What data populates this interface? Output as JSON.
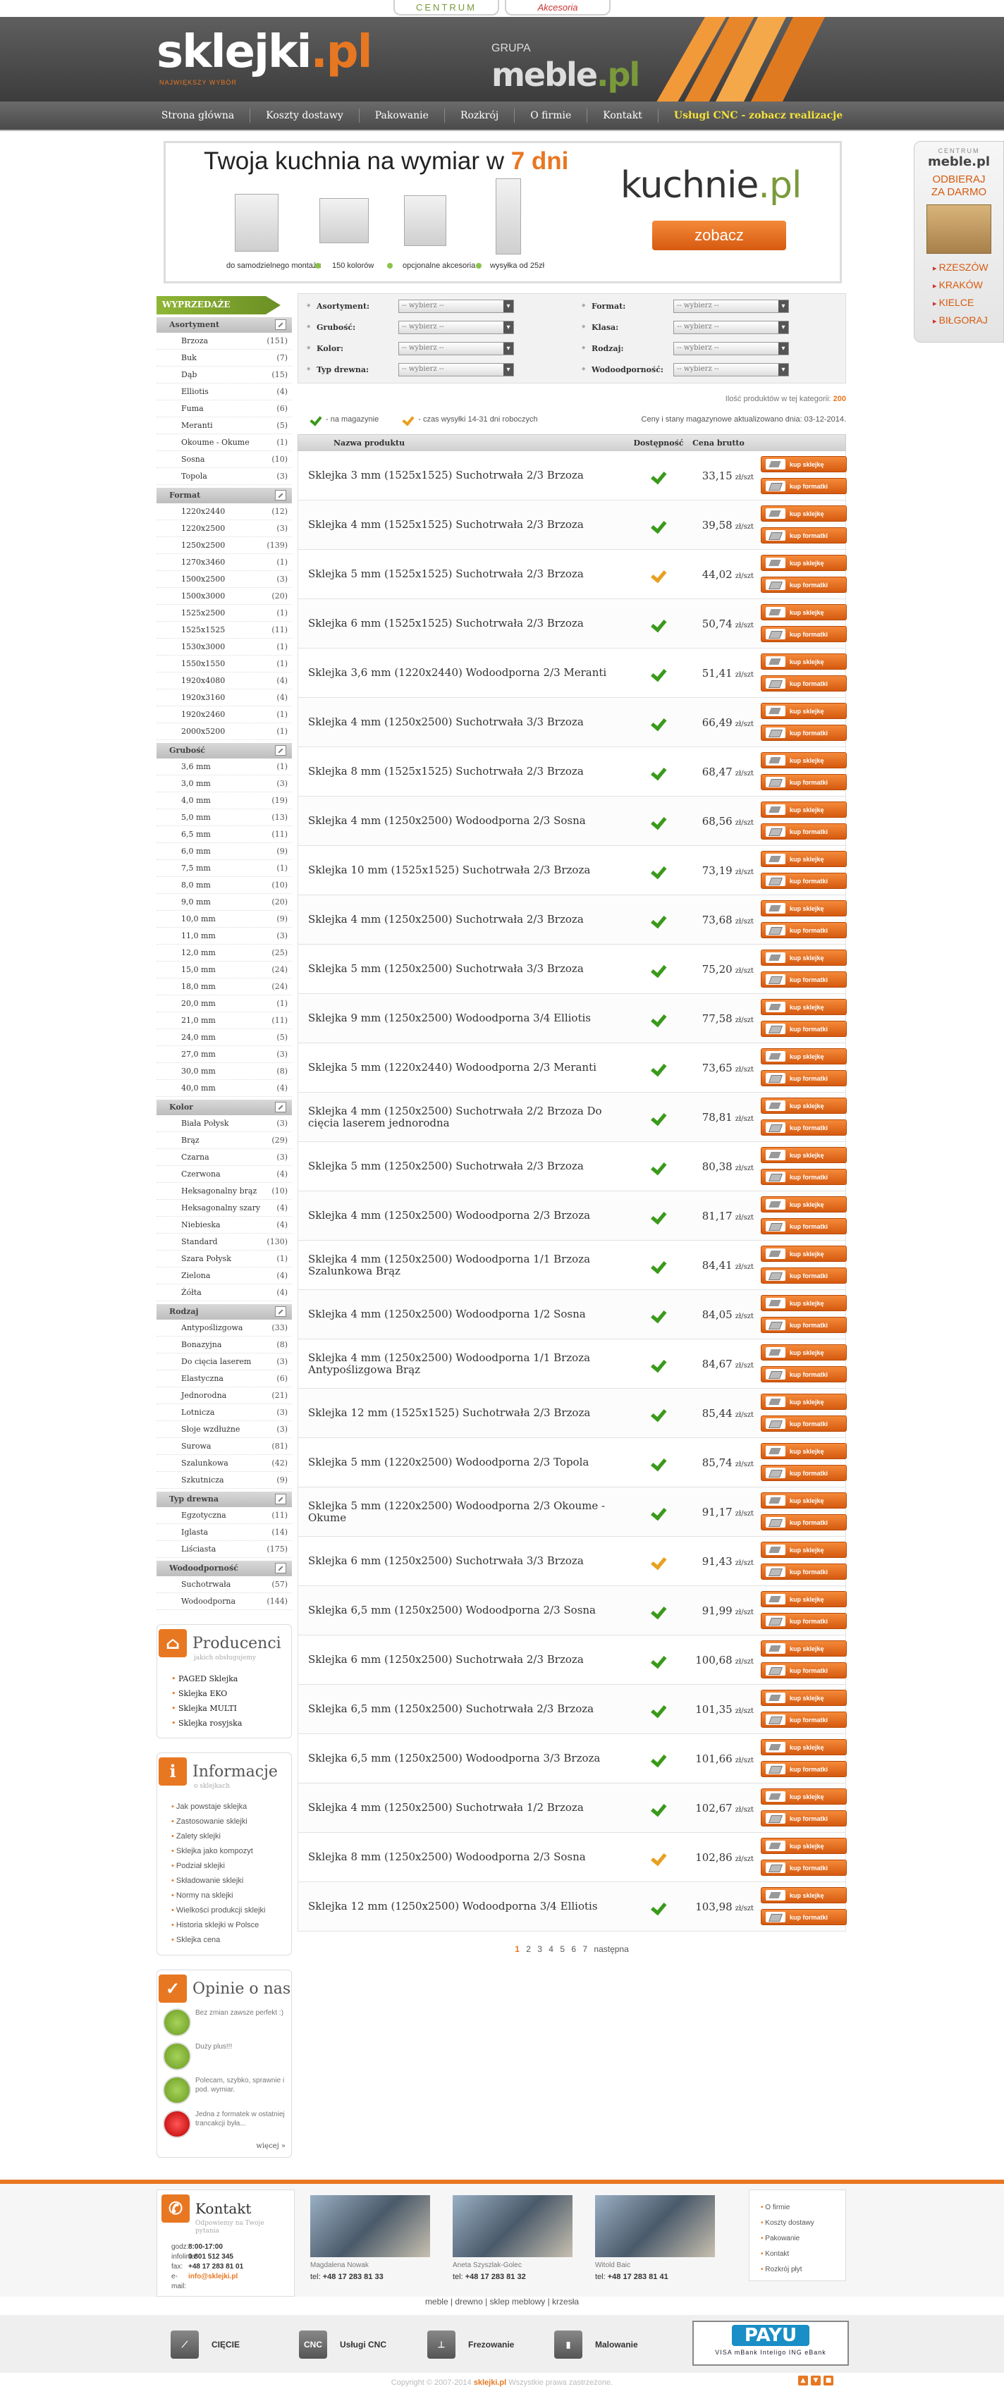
{
  "top_tabs": {
    "centrum": "CENTRUM",
    "akcesoria": "Akcesoria"
  },
  "header": {
    "logo": "sklejki",
    "logo_dot": ".pl",
    "logo_sub": "NAJWIĘKSZY WYBÓR",
    "grupa": "GRUPA",
    "meble": "meble",
    "meble_dot": ".pl"
  },
  "nav": [
    "Strona główna",
    "Koszty dostawy",
    "Pakowanie",
    "Rozkrój",
    "O firmie",
    "Kontakt",
    "Usługi CNC - zobacz realizacje"
  ],
  "banner": {
    "title_pre": "Twoja kuchnia na wymiar w ",
    "title_hl": "7 dni",
    "captions": [
      "do samodzielnego montażu",
      "150 kolorów",
      "opcjonalne akcesoria",
      "wysyłka od 25zł"
    ],
    "brand": "kuchnie",
    "brand_dot": ".pl",
    "cta": "zobacz"
  },
  "sidebox": {
    "centrum": "CENTRUM",
    "meble": "meble.pl",
    "odbieraj": "ODBIERAJ",
    "za_darmo": "ZA DARMO",
    "cities": [
      "RZESZÓW",
      "KRAKÓW",
      "KIELCE",
      "BIŁGORAJ"
    ]
  },
  "sidebar": {
    "wyprzedaze": "WYPRZEDAŻE",
    "groups": [
      {
        "title": "Asortyment",
        "items": [
          [
            "Brzoza",
            "(151)"
          ],
          [
            "Buk",
            "(7)"
          ],
          [
            "Dąb",
            "(15)"
          ],
          [
            "Elliotis",
            "(4)"
          ],
          [
            "Fuma",
            "(6)"
          ],
          [
            "Meranti",
            "(5)"
          ],
          [
            "Okoume - Okume",
            "(1)"
          ],
          [
            "Sosna",
            "(10)"
          ],
          [
            "Topola",
            "(3)"
          ]
        ]
      },
      {
        "title": "Format",
        "items": [
          [
            "1220x2440",
            "(12)"
          ],
          [
            "1220x2500",
            "(3)"
          ],
          [
            "1250x2500",
            "(139)"
          ],
          [
            "1270x3460",
            "(1)"
          ],
          [
            "1500x2500",
            "(3)"
          ],
          [
            "1500x3000",
            "(20)"
          ],
          [
            "1525x2500",
            "(1)"
          ],
          [
            "1525x1525",
            "(11)"
          ],
          [
            "1530x3000",
            "(1)"
          ],
          [
            "1550x1550",
            "(1)"
          ],
          [
            "1920x4080",
            "(4)"
          ],
          [
            "1920x3160",
            "(4)"
          ],
          [
            "1920x2460",
            "(1)"
          ],
          [
            "2000x5200",
            "(1)"
          ]
        ]
      },
      {
        "title": "Grubość",
        "items": [
          [
            "3,6 mm",
            "(1)"
          ],
          [
            "3,0 mm",
            "(3)"
          ],
          [
            "4,0 mm",
            "(19)"
          ],
          [
            "5,0 mm",
            "(13)"
          ],
          [
            "6,5 mm",
            "(11)"
          ],
          [
            "6,0 mm",
            "(9)"
          ],
          [
            "7,5 mm",
            "(1)"
          ],
          [
            "8,0 mm",
            "(10)"
          ],
          [
            "9,0 mm",
            "(20)"
          ],
          [
            "10,0 mm",
            "(9)"
          ],
          [
            "11,0 mm",
            "(3)"
          ],
          [
            "12,0 mm",
            "(25)"
          ],
          [
            "15,0 mm",
            "(24)"
          ],
          [
            "18,0 mm",
            "(24)"
          ],
          [
            "20,0 mm",
            "(1)"
          ],
          [
            "21,0 mm",
            "(11)"
          ],
          [
            "24,0 mm",
            "(5)"
          ],
          [
            "27,0 mm",
            "(3)"
          ],
          [
            "30,0 mm",
            "(8)"
          ],
          [
            "40,0 mm",
            "(4)"
          ]
        ]
      },
      {
        "title": "Kolor",
        "items": [
          [
            "Biała Połysk",
            "(3)"
          ],
          [
            "Brąz",
            "(29)"
          ],
          [
            "Czarna",
            "(3)"
          ],
          [
            "Czerwona",
            "(4)"
          ],
          [
            "Heksagonalny brąz",
            "(10)"
          ],
          [
            "Heksagonalny szary",
            "(4)"
          ],
          [
            "Niebieska",
            "(4)"
          ],
          [
            "Standard",
            "(130)"
          ],
          [
            "Szara Połysk",
            "(1)"
          ],
          [
            "Zielona",
            "(4)"
          ],
          [
            "Żółta",
            "(4)"
          ]
        ]
      },
      {
        "title": "Rodzaj",
        "items": [
          [
            "Antypoślizgowa",
            "(33)"
          ],
          [
            "Bonazyjna",
            "(8)"
          ],
          [
            "Do cięcia laserem",
            "(3)"
          ],
          [
            "Elastyczna",
            "(6)"
          ],
          [
            "Jednorodna",
            "(21)"
          ],
          [
            "Lotnicza",
            "(3)"
          ],
          [
            "Słoje wzdłużne",
            "(3)"
          ],
          [
            "Surowa",
            "(81)"
          ],
          [
            "Szalunkowa",
            "(42)"
          ],
          [
            "Szkutnicza",
            "(9)"
          ]
        ]
      },
      {
        "title": "Typ drewna",
        "items": [
          [
            "Egzotyczna",
            "(11)"
          ],
          [
            "Iglasta",
            "(14)"
          ],
          [
            "Liściasta",
            "(175)"
          ]
        ]
      },
      {
        "title": "Wodoodporność",
        "items": [
          [
            "Suchotrwała",
            "(57)"
          ],
          [
            "Wodoodporna",
            "(144)"
          ]
        ]
      }
    ],
    "producenci": {
      "title": "Producenci",
      "sub": "jakich obsługujemy",
      "items": [
        "PAGED Sklejka",
        "Sklejka EKO",
        "Sklejka MULTI",
        "Sklejka rosyjska"
      ]
    },
    "informacje": {
      "title": "Informacje",
      "sub": "o sklejkach",
      "items": [
        "Jak powstaje sklejka",
        "Zastosowanie sklejki",
        "Zalety sklejki",
        "Sklejka jako kompozyt",
        "Podział sklejki",
        "Składowanie sklejki",
        "Normy na sklejki",
        "Wielkości produkcji sklejki",
        "Historia sklejki w Polsce",
        "Sklejka cena"
      ]
    },
    "opinie": {
      "title": "Opinie o nas",
      "items": [
        "Bez zmian zawsze perfekt :)",
        "Duży plus!!!",
        "Polecam, szybko, sprawnie i pod. wymiar.",
        "Jedna z formatek w ostatniej trancakcji była..."
      ],
      "more": "więcej »"
    }
  },
  "filters": {
    "left": [
      "Asortyment:",
      "Grubość:",
      "Kolor:",
      "Typ drewna:"
    ],
    "right": [
      "Format:",
      "Klasa:",
      "Rodzaj:",
      "Wodoodporność:"
    ],
    "placeholder": "-- wybierz --"
  },
  "count": {
    "label": "Ilość produktów w tej kategorii:",
    "value": "200"
  },
  "legend": {
    "mag": "- na magazynie",
    "czas": "- czas wysyłki 14-31 dni roboczych",
    "info": "Ceny i stany magazynowe aktualizowano dnia: 03-12-2014."
  },
  "table": {
    "col_name": "Nazwa produktu",
    "col_dost": "Dostępność",
    "col_cena": "Cena brutto",
    "unit": "zł/szt",
    "btn_kup": "kup sklejkę",
    "btn_form": "kup formatki"
  },
  "products": [
    {
      "name": "Sklejka 3 mm (1525x1525) Suchotrwała 2/3 Brzoza",
      "price": "33,15",
      "avail": "g"
    },
    {
      "name": "Sklejka 4 mm (1525x1525) Suchotrwała 2/3 Brzoza",
      "price": "39,58",
      "avail": "g"
    },
    {
      "name": "Sklejka 5 mm (1525x1525) Suchotrwała 2/3 Brzoza",
      "price": "44,02",
      "avail": "y"
    },
    {
      "name": "Sklejka 6 mm (1525x1525) Suchotrwała 2/3 Brzoza",
      "price": "50,74",
      "avail": "g"
    },
    {
      "name": "Sklejka 3,6 mm (1220x2440) Wodoodporna 2/3 Meranti",
      "price": "51,41",
      "avail": "g"
    },
    {
      "name": "Sklejka 4 mm (1250x2500) Suchotrwała 3/3 Brzoza",
      "price": "66,49",
      "avail": "g"
    },
    {
      "name": "Sklejka 8 mm (1525x1525) Suchotrwała 2/3 Brzoza",
      "price": "68,47",
      "avail": "g"
    },
    {
      "name": "Sklejka 4 mm (1250x2500) Wodoodporna 2/3 Sosna",
      "price": "68,56",
      "avail": "g"
    },
    {
      "name": "Sklejka 10 mm (1525x1525) Suchotrwała 2/3 Brzoza",
      "price": "73,19",
      "avail": "g"
    },
    {
      "name": "Sklejka 4 mm (1250x2500) Suchotrwała 2/3 Brzoza",
      "price": "73,68",
      "avail": "g"
    },
    {
      "name": "Sklejka 5 mm (1250x2500) Suchotrwała 3/3 Brzoza",
      "price": "75,20",
      "avail": "g"
    },
    {
      "name": "Sklejka 9 mm (1250x2500) Wodoodporna 3/4 Elliotis",
      "price": "77,58",
      "avail": "g"
    },
    {
      "name": "Sklejka 5 mm (1220x2440) Wodoodporna 2/3 Meranti",
      "price": "73,65",
      "avail": "g"
    },
    {
      "name": "Sklejka 4 mm (1250x2500) Suchotrwała 2/2 Brzoza Do cięcia laserem jednorodna",
      "price": "78,81",
      "avail": "g"
    },
    {
      "name": "Sklejka 5 mm (1250x2500) Suchotrwała 2/3 Brzoza",
      "price": "80,38",
      "avail": "g"
    },
    {
      "name": "Sklejka 4 mm (1250x2500) Wodoodporna 2/3 Brzoza",
      "price": "81,17",
      "avail": "g"
    },
    {
      "name": "Sklejka 4 mm (1250x2500) Wodoodporna 1/1 Brzoza Szalunkowa Brąz",
      "price": "84,41",
      "avail": "g"
    },
    {
      "name": "Sklejka 4 mm (1250x2500) Wodoodporna 1/2 Sosna",
      "price": "84,05",
      "avail": "g"
    },
    {
      "name": "Sklejka 4 mm (1250x2500) Wodoodporna 1/1 Brzoza Antypoślizgowa Brąz",
      "price": "84,67",
      "avail": "g"
    },
    {
      "name": "Sklejka 12 mm (1525x1525) Suchotrwała 2/3 Brzoza",
      "price": "85,44",
      "avail": "g"
    },
    {
      "name": "Sklejka 5 mm (1220x2500) Wodoodporna 2/3 Topola",
      "price": "85,74",
      "avail": "g"
    },
    {
      "name": "Sklejka 5 mm (1220x2500) Wodoodporna 2/3 Okoume - Okume",
      "price": "91,17",
      "avail": "g"
    },
    {
      "name": "Sklejka 6 mm (1250x2500) Suchotrwała 3/3 Brzoza",
      "price": "91,43",
      "avail": "y"
    },
    {
      "name": "Sklejka 6,5 mm (1250x2500) Wodoodporna 2/3 Sosna",
      "price": "91,99",
      "avail": "g"
    },
    {
      "name": "Sklejka 6 mm (1250x2500) Suchotrwała 2/3 Brzoza",
      "price": "100,68",
      "avail": "g"
    },
    {
      "name": "Sklejka 6,5 mm (1250x2500) Suchotrwała 2/3 Brzoza",
      "price": "101,35",
      "avail": "g"
    },
    {
      "name": "Sklejka 6,5 mm (1250x2500) Wodoodporna 3/3 Brzoza",
      "price": "101,66",
      "avail": "g"
    },
    {
      "name": "Sklejka 4 mm (1250x2500) Suchotrwała 1/2 Brzoza",
      "price": "102,67",
      "avail": "g"
    },
    {
      "name": "Sklejka 8 mm (1250x2500) Wodoodporna 2/3 Sosna",
      "price": "102,86",
      "avail": "y"
    },
    {
      "name": "Sklejka 12 mm (1250x2500) Wodoodporna 3/4 Elliotis",
      "price": "103,98",
      "avail": "g"
    }
  ],
  "pager": {
    "pages": [
      "1",
      "2",
      "3",
      "4",
      "5",
      "6",
      "7"
    ],
    "next": "następna"
  },
  "footer": {
    "kontakt": {
      "title": "Kontakt",
      "sub": "Odpowiemy na Twoje pytania",
      "rows": [
        [
          "godz:",
          "8:00-17:00"
        ],
        [
          "infolinia:",
          "0 801 512 345"
        ],
        [
          "fax:",
          "+48 17 283 81 01"
        ],
        [
          "e-mail:",
          "info@sklejki.pl"
        ]
      ]
    },
    "people": [
      {
        "name": "Magdalena Nowak",
        "tel": "+48 17 283 81 33"
      },
      {
        "name": "Aneta Szyszlak-Golec",
        "tel": "+48 17 283 81 32"
      },
      {
        "name": "Witold Baic",
        "tel": "+48 17 283 81 41"
      }
    ],
    "tel_label": "tel:",
    "links": [
      "O firmie",
      "Koszty dostawy",
      "Pakowanie",
      "Kontakt",
      "Rozkrój płyt"
    ],
    "seo": "meble | drewno | sklep meblowy | krzesła",
    "services": [
      {
        "icon": "cut",
        "label": "CIĘCIE"
      },
      {
        "icon": "CNC",
        "label": "Usługi CNC"
      },
      {
        "icon": "mill",
        "label": "Frezowanie"
      },
      {
        "icon": "paint",
        "label": "Malowanie"
      }
    ],
    "payu": {
      "logo": "PAYU",
      "cards": "VISA  mBank  Inteligo  ING  eBank"
    },
    "copy_pre": "Copyright © 2007-2014 ",
    "copy_brand": "sklejki.pl",
    "copy_post": " Wszystkie prawa zastrzeżone."
  }
}
